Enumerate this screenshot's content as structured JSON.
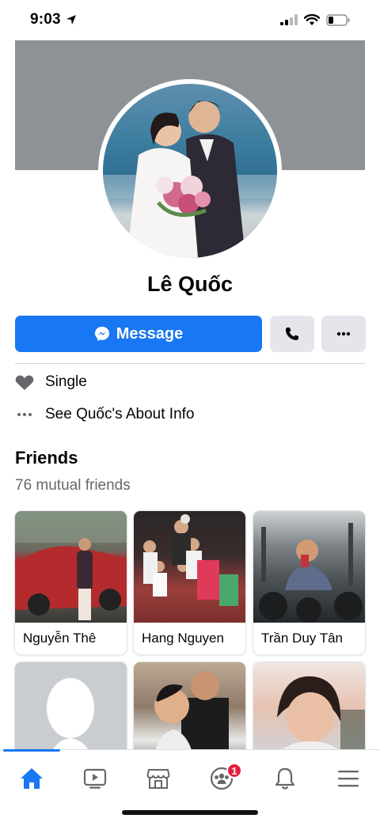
{
  "status_bar": {
    "time": "9:03"
  },
  "profile": {
    "name": "Lê Quốc",
    "message_label": "Message"
  },
  "info": {
    "relationship": "Single",
    "about_link": "See Quốc's About Info"
  },
  "friends": {
    "title": "Friends",
    "mutual_count": "76 mutual friends",
    "cards": [
      {
        "name": "Nguyễn Thê"
      },
      {
        "name": "Hang Nguyen"
      },
      {
        "name": "Trần Duy Tân"
      },
      {
        "name": ""
      },
      {
        "name": ""
      },
      {
        "name": ""
      }
    ]
  },
  "bottom_nav": {
    "items": [
      {
        "icon": "home-icon"
      },
      {
        "icon": "watch-icon"
      },
      {
        "icon": "marketplace-icon"
      },
      {
        "icon": "groups-icon",
        "badge": "1"
      },
      {
        "icon": "bell-icon"
      },
      {
        "icon": "menu-icon"
      }
    ]
  },
  "colors": {
    "accent": "#1877f2",
    "badge": "#e41e3f",
    "cover": "#8e9196"
  }
}
